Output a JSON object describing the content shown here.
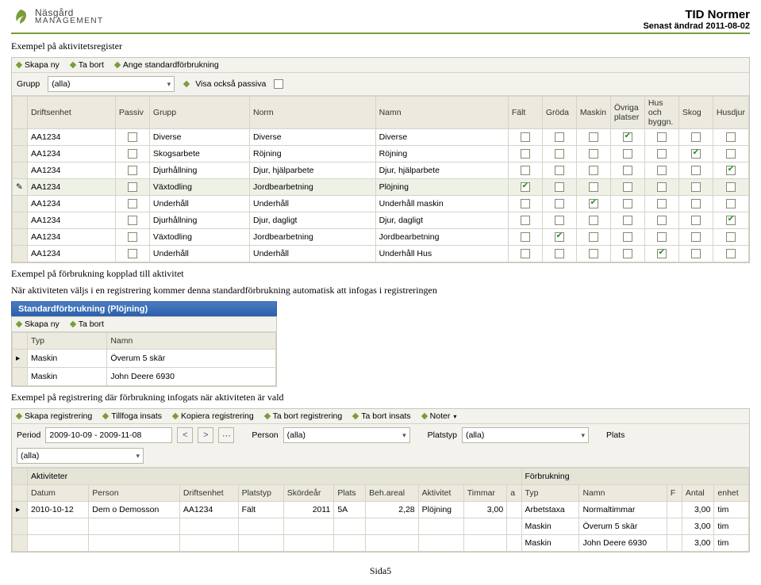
{
  "header": {
    "title": "TID Normer",
    "subtitle": "Senast ändrad 2011-08-02",
    "logo1": "Näsgård",
    "logo2": "MANAGEMENT"
  },
  "p1": "Exempel på aktivitetsregister",
  "p2": "Exempel på förbrukning kopplad till aktivitet",
  "p3": "När aktiviteten väljs i en registrering kommer denna standardförbrukning automatisk att infogas i registreringen",
  "p4": "Exempel på registrering där förbrukning infogats när aktiviteten är vald",
  "footer": "Sida5",
  "tb1": {
    "new": "Skapa ny",
    "del": "Ta bort",
    "std": "Ange standardförbrukning",
    "u": {
      "new": "n",
      "del": "T",
      "std": "A"
    }
  },
  "f1": {
    "lblGroup": "Grupp",
    "groupVal": "(alla)",
    "lblPassive": "Visa också passiva"
  },
  "grid1": {
    "cols": [
      "Driftsenhet",
      "Passiv",
      "Grupp",
      "Norm",
      "Namn",
      "Fält",
      "Gröda",
      "Maskin",
      "Övriga platser",
      "Hus och byggn.",
      "Skog",
      "Husdjur"
    ],
    "rows": [
      {
        "d": "AA1234",
        "p": false,
        "g": "Diverse",
        "no": "Diverse",
        "na": "Diverse",
        "c": [
          false,
          false,
          false,
          true,
          false,
          false,
          false
        ]
      },
      {
        "d": "AA1234",
        "p": false,
        "g": "Skogsarbete",
        "no": "Röjning",
        "na": "Röjning",
        "c": [
          false,
          false,
          false,
          false,
          false,
          true,
          false
        ]
      },
      {
        "d": "AA1234",
        "p": false,
        "g": "Djurhållning",
        "no": "Djur, hjälparbete",
        "na": "Djur, hjälparbete",
        "c": [
          false,
          false,
          false,
          false,
          false,
          false,
          true
        ]
      },
      {
        "d": "AA1234",
        "p": false,
        "g": "Växtodling",
        "no": "Jordbearbetning",
        "na": "Plöjning",
        "c": [
          true,
          false,
          false,
          false,
          false,
          false,
          false
        ],
        "sel": true,
        "mark": true
      },
      {
        "d": "AA1234",
        "p": false,
        "g": "Underhåll",
        "no": "Underhåll",
        "na": "Underhåll maskin",
        "c": [
          false,
          false,
          true,
          false,
          false,
          false,
          false
        ]
      },
      {
        "d": "AA1234",
        "p": false,
        "g": "Djurhållning",
        "no": "Djur, dagligt",
        "na": "Djur, dagligt",
        "c": [
          false,
          false,
          false,
          false,
          false,
          false,
          true
        ]
      },
      {
        "d": "AA1234",
        "p": false,
        "g": "Växtodling",
        "no": "Jordbearbetning",
        "na": "Jordbearbetning",
        "c": [
          false,
          true,
          false,
          false,
          false,
          false,
          false
        ]
      },
      {
        "d": "AA1234",
        "p": false,
        "g": "Underhåll",
        "no": "Underhåll",
        "na": "Underhåll Hus",
        "c": [
          false,
          false,
          false,
          false,
          true,
          false,
          false
        ]
      }
    ]
  },
  "tb2": {
    "title": "Standardförbrukning (Plöjning)",
    "new": "Skapa ny",
    "del": "Ta bort"
  },
  "grid2": {
    "cols": [
      "Typ",
      "Namn"
    ],
    "rows": [
      {
        "t": "Maskin",
        "n": "Överum 5 skär",
        "mark": true
      },
      {
        "t": "Maskin",
        "n": "John Deere 6930"
      }
    ]
  },
  "tb3": {
    "a": "Skapa registrering",
    "b": "Tillfoga insats",
    "c": "Kopiera registrering",
    "d": "Ta bort registrering",
    "e": "Ta bort insats",
    "f": "Noter"
  },
  "f3": {
    "lblPeriod": "Period",
    "periodVal": "2009-10-09 - 2009-11-08",
    "lblPerson": "Person",
    "personVal": "(alla)",
    "lblPlatsTyp": "Platstyp",
    "platsTypVal": "(alla)",
    "lblPlats": "Plats",
    "platsVal": "(alla)"
  },
  "grid3": {
    "band": {
      "a": "Aktiviteter",
      "b": "Förbrukning"
    },
    "cols": [
      "Datum",
      "Person",
      "Driftsenhet",
      "Platstyp",
      "Skördeår",
      "Plats",
      "Beh.areal",
      "Aktivitet",
      "Timmar",
      "a",
      "Typ",
      "Namn",
      "F",
      "Antal",
      "enhet"
    ],
    "row0": {
      "date": "2010-10-12",
      "person": "Dem o Demosson",
      "de": "AA1234",
      "pt": "Fält",
      "yr": "2011",
      "pl": "5A",
      "ar": "2,28",
      "ak": "Plöjning",
      "tim": "3,00",
      "typ": "Arbetstaxa",
      "namn": "Normaltimmar",
      "ant": "3,00",
      "en": "tim"
    },
    "row1": {
      "typ": "Maskin",
      "namn": "Överum 5 skär",
      "ant": "3,00",
      "en": "tim"
    },
    "row2": {
      "typ": "Maskin",
      "namn": "John Deere 6930",
      "ant": "3,00",
      "en": "tim"
    }
  }
}
